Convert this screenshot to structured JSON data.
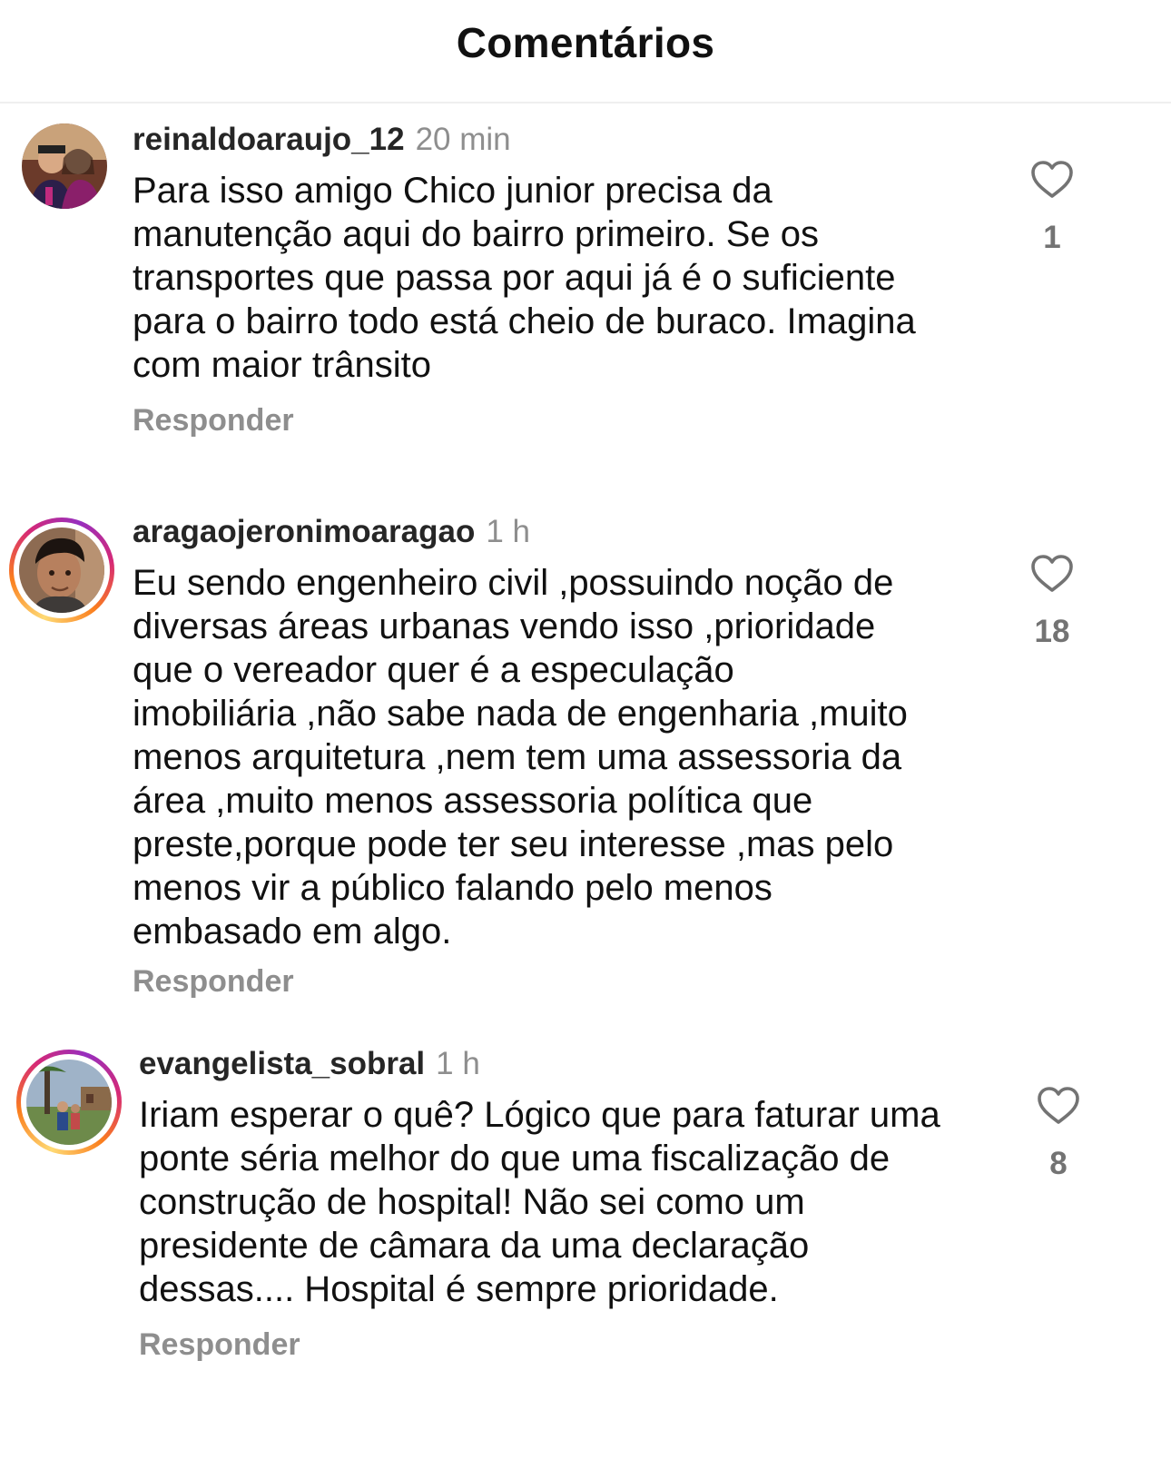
{
  "header": {
    "title": "Comentários"
  },
  "reply_label": "Responder",
  "colors": {
    "username": "#262626",
    "muted": "#8e8e8e",
    "story_ring": [
      "#feda75",
      "#fa7e1e",
      "#d62976",
      "#962fbf"
    ]
  },
  "comments": [
    {
      "username": "reinaldoaraujo_12",
      "time": "20 min",
      "has_story_ring": false,
      "lines": [
        "Para isso amigo Chico junior precisa da",
        "manutenção aqui do bairro primeiro. Se os",
        "transportes que passa por aqui já é o suficiente",
        "para o bairro todo está cheio de buraco. Imagina",
        "com maior trânsito"
      ],
      "likes": "1",
      "like_icon": "heart-outline-icon"
    },
    {
      "username": "aragaojeronimoaragao",
      "time": "1 h",
      "has_story_ring": true,
      "lines": [
        "Eu sendo engenheiro civil ,possuindo noção de",
        "diversas áreas urbanas vendo isso ,prioridade",
        "que o vereador quer é a especulação",
        "imobiliária ,não sabe nada de engenharia ,muito",
        "menos arquitetura ,nem tem uma assessoria da",
        "área ,muito menos assessoria política que",
        "preste,porque pode ter seu interesse ,mas pelo",
        "menos vir a público falando pelo menos",
        "embasado em algo."
      ],
      "likes": "18",
      "like_icon": "heart-outline-icon"
    },
    {
      "username": "evangelista_sobral",
      "time": "1 h",
      "has_story_ring": true,
      "lines": [
        "Iriam esperar o quê? Lógico que para faturar uma",
        "ponte séria melhor do que uma fiscalização de",
        "construção de hospital! Não sei como um",
        "presidente de câmara da uma declaração",
        "dessas.... Hospital é sempre prioridade."
      ],
      "likes": "8",
      "like_icon": "heart-outline-icon"
    }
  ]
}
